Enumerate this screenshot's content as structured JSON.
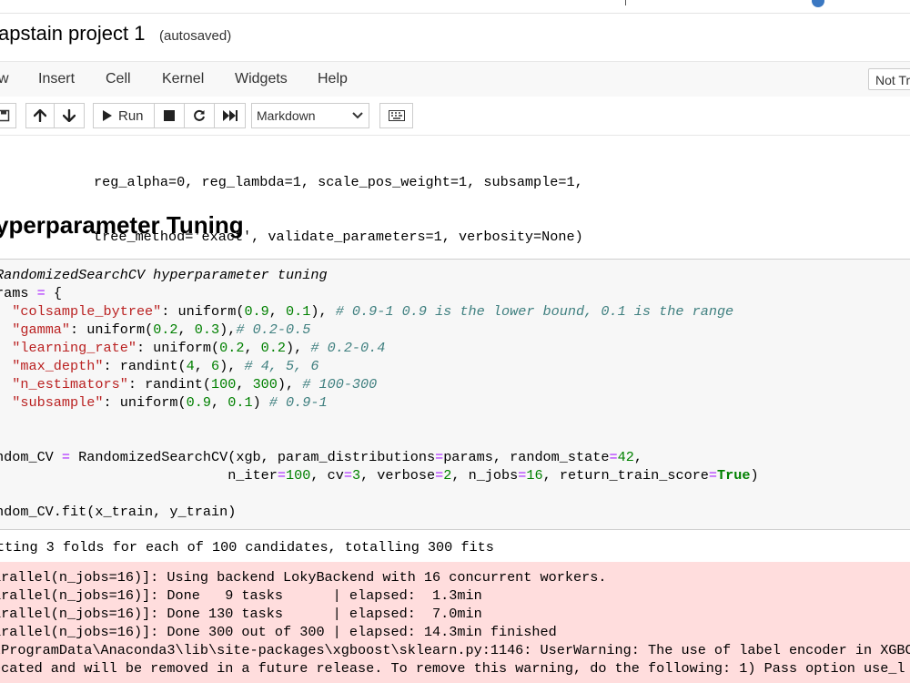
{
  "header": {
    "notebook_title": "apstain project 1",
    "autosave_status": "(autosaved)"
  },
  "menubar": {
    "items": [
      "w",
      "Insert",
      "Cell",
      "Kernel",
      "Widgets",
      "Help"
    ],
    "trust_label": "Not Tr"
  },
  "toolbar": {
    "run_label": "Run",
    "cell_type": "Markdown",
    "icons": [
      "save-icon",
      "arrow-up-icon",
      "arrow-down-icon",
      "play-icon",
      "stop-icon",
      "restart-icon",
      "fast-forward-icon",
      "keyboard-icon"
    ]
  },
  "previous_output": [
    "reg_alpha=0, reg_lambda=1, scale_pos_weight=1, subsample=1,",
    "tree_method='exact', validate_parameters=1, verbosity=None)"
  ],
  "section_heading": "yperparameter Tuning",
  "code_cell": {
    "lines": [
      "RandomizedSearchCV hyperparameter tuning",
      "rams = {",
      "  \"colsample_bytree\": uniform(0.9, 0.1), # 0.9-1 0.9 is the lower bound, 0.1 is the range",
      "  \"gamma\": uniform(0.2, 0.3),# 0.2-0.5",
      "  \"learning_rate\": uniform(0.2, 0.2), # 0.2-0.4",
      "  \"max_depth\": randint(4, 6), # 4, 5, 6",
      "  \"n_estimators\": randint(100, 300), # 100-300",
      "  \"subsample\": uniform(0.9, 0.1) # 0.9-1",
      "",
      "ndom_CV = RandomizedSearchCV(xgb, param_distributions=params, random_state=42,",
      "                            n_iter=100, cv=3, verbose=2, n_jobs=16, return_train_score=True)",
      "ndom_CV.fit(x_train, y_train)"
    ]
  },
  "stdout": "tting 3 folds for each of 100 candidates, totalling 300 fits",
  "stderr": [
    "arallel(n_jobs=16)]: Using backend LokyBackend with 16 concurrent workers.",
    "arallel(n_jobs=16)]: Done   9 tasks      | elapsed:  1.3min",
    "arallel(n_jobs=16)]: Done 130 tasks      | elapsed:  7.0min",
    "arallel(n_jobs=16)]: Done 300 out of 300 | elapsed: 14.3min finished",
    "\\ProgramData\\Anaconda3\\lib\\site-packages\\xgboost\\sklearn.py:1146: UserWarning: The use of label encoder in XGBC",
    "ecated and will be removed in a future release. To remove this warning, do the following: 1) Pass option use_l"
  ],
  "colors": {
    "menubar_bg": "#f8f8f8",
    "code_bg": "#f7f7f7",
    "stderr_bg": "#ffdddd",
    "comment": "#408080",
    "string": "#ba2121",
    "number": "#008000",
    "operator": "#aa22ff"
  }
}
